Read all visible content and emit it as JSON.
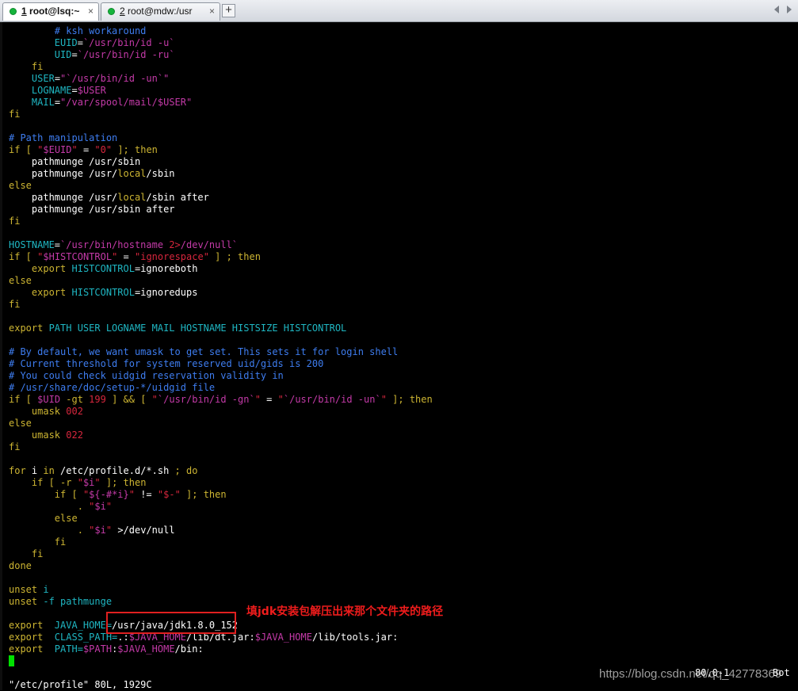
{
  "tabs": [
    {
      "number": "1",
      "title": " root@lsq:~",
      "close": "×"
    },
    {
      "number": "2",
      "title": " root@mdw:/usr",
      "close": "×"
    }
  ],
  "new_tab": "+",
  "colors": {
    "comment": "#3e7df0",
    "keyword": "#cdb532",
    "string": "#d7263d",
    "variable": "#c43aa8",
    "builtin": "#1fb6c2",
    "cursor": "#00e000",
    "annotation": "#ee1c1c"
  },
  "lines": [
    [
      [
        "        ",
        ""
      ],
      [
        "# ksh workaround",
        "c"
      ]
    ],
    [
      [
        "        ",
        ""
      ],
      [
        "EUID",
        "cy"
      ],
      [
        "=",
        ""
      ],
      [
        "`/usr/bin/id -u`",
        "v"
      ]
    ],
    [
      [
        "        ",
        ""
      ],
      [
        "UID",
        "cy"
      ],
      [
        "=",
        ""
      ],
      [
        "`/usr/bin/id -ru`",
        "v"
      ]
    ],
    [
      [
        "    ",
        ""
      ],
      [
        "fi",
        "k"
      ]
    ],
    [
      [
        "    ",
        ""
      ],
      [
        "USER",
        "cy"
      ],
      [
        "=",
        ""
      ],
      [
        "\"`/usr/bin/id -un`\"",
        "v"
      ]
    ],
    [
      [
        "    ",
        ""
      ],
      [
        "LOGNAME",
        "cy"
      ],
      [
        "=",
        ""
      ],
      [
        "$USER",
        "v"
      ]
    ],
    [
      [
        "    ",
        ""
      ],
      [
        "MAIL",
        "cy"
      ],
      [
        "=",
        ""
      ],
      [
        "\"/var/spool/mail/$USER\"",
        "v"
      ]
    ],
    [
      [
        "fi",
        "k"
      ]
    ],
    [
      [
        "",
        ""
      ]
    ],
    [
      [
        "# Path manipulation",
        "c"
      ]
    ],
    [
      [
        "if",
        "k"
      ],
      [
        " [ ",
        "k"
      ],
      [
        "\"",
        "s"
      ],
      [
        "$EUID",
        "v"
      ],
      [
        "\"",
        "s"
      ],
      [
        " = ",
        ""
      ],
      [
        "\"0\"",
        "s"
      ],
      [
        " ]; then",
        "k"
      ]
    ],
    [
      [
        "    pathmunge /usr/sbin",
        ""
      ]
    ],
    [
      [
        "    pathmunge /usr/",
        ""
      ],
      [
        "local",
        "k"
      ],
      [
        "/sbin",
        ""
      ]
    ],
    [
      [
        "else",
        "k"
      ]
    ],
    [
      [
        "    pathmunge /usr/",
        ""
      ],
      [
        "local",
        "k"
      ],
      [
        "/sbin after",
        ""
      ]
    ],
    [
      [
        "    pathmunge /usr/sbin after",
        ""
      ]
    ],
    [
      [
        "fi",
        "k"
      ]
    ],
    [
      [
        "",
        ""
      ]
    ],
    [
      [
        "HOSTNAME",
        "cy"
      ],
      [
        "=",
        ""
      ],
      [
        "`/usr/bin/hostname ",
        "v"
      ],
      [
        "2>",
        "s"
      ],
      [
        "/dev/null`",
        "v"
      ]
    ],
    [
      [
        "if",
        "k"
      ],
      [
        " [ ",
        "k"
      ],
      [
        "\"",
        "s"
      ],
      [
        "$HISTCONTROL",
        "v"
      ],
      [
        "\"",
        "s"
      ],
      [
        " = ",
        ""
      ],
      [
        "\"ignorespace\"",
        "s"
      ],
      [
        " ] ; then",
        "k"
      ]
    ],
    [
      [
        "    ",
        ""
      ],
      [
        "export",
        "k"
      ],
      [
        " ",
        ""
      ],
      [
        "HISTCONTROL",
        "cy"
      ],
      [
        "=ignoreboth",
        ""
      ]
    ],
    [
      [
        "else",
        "k"
      ]
    ],
    [
      [
        "    ",
        ""
      ],
      [
        "export",
        "k"
      ],
      [
        " ",
        ""
      ],
      [
        "HISTCONTROL",
        "cy"
      ],
      [
        "=ignoredups",
        ""
      ]
    ],
    [
      [
        "fi",
        "k"
      ]
    ],
    [
      [
        "",
        ""
      ]
    ],
    [
      [
        "export",
        "k"
      ],
      [
        " PATH USER LOGNAME MAIL HOSTNAME HISTSIZE HISTCONTROL",
        "cy"
      ]
    ],
    [
      [
        "",
        ""
      ]
    ],
    [
      [
        "# By default, we want umask to get set. This sets it for login shell",
        "c"
      ]
    ],
    [
      [
        "# Current threshold for system reserved uid/gids is 200",
        "c"
      ]
    ],
    [
      [
        "# You could check uidgid reservation validity in",
        "c"
      ]
    ],
    [
      [
        "# /usr/share/doc/setup-*/uidgid file",
        "c"
      ]
    ],
    [
      [
        "if",
        "k"
      ],
      [
        " [ ",
        "k"
      ],
      [
        "$UID",
        "v"
      ],
      [
        " -gt ",
        "k"
      ],
      [
        "199",
        "s"
      ],
      [
        " ] && [ ",
        "k"
      ],
      [
        "\"",
        "s"
      ],
      [
        "`/usr/bin/id -gn`",
        "v"
      ],
      [
        "\"",
        "s"
      ],
      [
        " = ",
        ""
      ],
      [
        "\"",
        "s"
      ],
      [
        "`/usr/bin/id -un`",
        "v"
      ],
      [
        "\"",
        "s"
      ],
      [
        " ]; then",
        "k"
      ]
    ],
    [
      [
        "    ",
        ""
      ],
      [
        "umask",
        "k"
      ],
      [
        " ",
        ""
      ],
      [
        "002",
        "s"
      ]
    ],
    [
      [
        "else",
        "k"
      ]
    ],
    [
      [
        "    ",
        ""
      ],
      [
        "umask",
        "k"
      ],
      [
        " ",
        ""
      ],
      [
        "022",
        "s"
      ]
    ],
    [
      [
        "fi",
        "k"
      ]
    ],
    [
      [
        "",
        ""
      ]
    ],
    [
      [
        "for",
        "k"
      ],
      [
        " i ",
        ""
      ],
      [
        "in",
        "k"
      ],
      [
        " /etc/profile.d/*.sh ",
        ""
      ],
      [
        "; do",
        "k"
      ]
    ],
    [
      [
        "    ",
        ""
      ],
      [
        "if",
        "k"
      ],
      [
        " [ -r ",
        "k"
      ],
      [
        "\"",
        "s"
      ],
      [
        "$i",
        "v"
      ],
      [
        "\"",
        "s"
      ],
      [
        " ]; then",
        "k"
      ]
    ],
    [
      [
        "        ",
        ""
      ],
      [
        "if",
        "k"
      ],
      [
        " [ ",
        "k"
      ],
      [
        "\"",
        "s"
      ],
      [
        "${-#*i}",
        "v"
      ],
      [
        "\"",
        "s"
      ],
      [
        " != ",
        ""
      ],
      [
        "\"$-\"",
        "s"
      ],
      [
        " ]; then",
        "k"
      ]
    ],
    [
      [
        "            ",
        ""
      ],
      [
        ".",
        "k"
      ],
      [
        " ",
        ""
      ],
      [
        "\"",
        "s"
      ],
      [
        "$i",
        "v"
      ],
      [
        "\"",
        "s"
      ]
    ],
    [
      [
        "        ",
        ""
      ],
      [
        "else",
        "k"
      ]
    ],
    [
      [
        "            ",
        ""
      ],
      [
        ".",
        "k"
      ],
      [
        " ",
        ""
      ],
      [
        "\"",
        "s"
      ],
      [
        "$i",
        "v"
      ],
      [
        "\"",
        "s"
      ],
      [
        " >/dev/null",
        ""
      ]
    ],
    [
      [
        "        ",
        ""
      ],
      [
        "fi",
        "k"
      ]
    ],
    [
      [
        "    ",
        ""
      ],
      [
        "fi",
        "k"
      ]
    ],
    [
      [
        "done",
        "k"
      ]
    ],
    [
      [
        "",
        ""
      ]
    ],
    [
      [
        "unset",
        "k"
      ],
      [
        " i",
        "cy"
      ]
    ],
    [
      [
        "unset",
        "k"
      ],
      [
        " -f pathmunge",
        "cy"
      ]
    ],
    [
      [
        "",
        ""
      ]
    ],
    [
      [
        "export",
        "k"
      ],
      [
        "  JAVA_HOME=",
        "cy"
      ],
      [
        "/usr/java/jdk1.8.0_152",
        ""
      ]
    ],
    [
      [
        "export",
        "k"
      ],
      [
        "  CLASS_PATH=",
        "cy"
      ],
      [
        ".:",
        ""
      ],
      [
        "$JAVA_HOME",
        "v"
      ],
      [
        "/lib/dt.jar:",
        ""
      ],
      [
        "$JAVA_HOME",
        "v"
      ],
      [
        "/lib/tools.jar:",
        ""
      ]
    ],
    [
      [
        "export",
        "k"
      ],
      [
        "  PATH=",
        "cy"
      ],
      [
        "$PATH",
        "v"
      ],
      [
        ":",
        ""
      ],
      [
        "$JAVA_HOME",
        "v"
      ],
      [
        "/bin:",
        ""
      ]
    ],
    [
      [
        "",
        ""
      ]
    ],
    [
      [
        "",
        ""
      ]
    ],
    [
      [
        "\"/etc/profile\" 80L, 1929C",
        ""
      ]
    ]
  ],
  "status_position": "80,0-1",
  "status_scroll": "Bot",
  "annotation_text": "填jdk安装包解压出来那个文件夹的路径",
  "watermark": "https://blog.csdn.net/qq_42778369"
}
